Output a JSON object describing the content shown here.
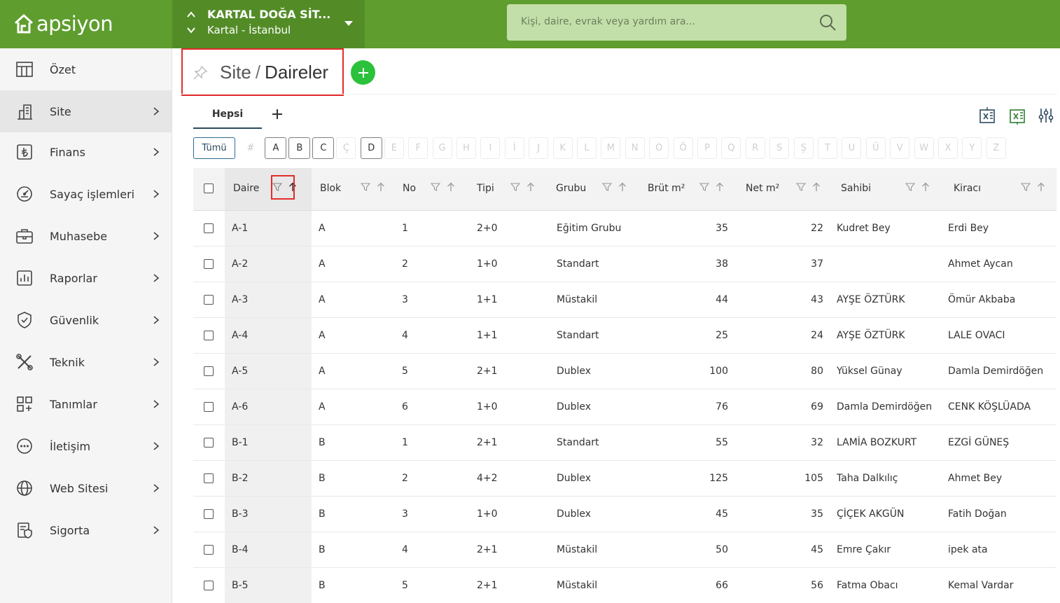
{
  "brand": {
    "name": "apsiyon"
  },
  "site_switch": {
    "name": "KARTAL DOĞA SİT...",
    "location": "Kartal - İstanbul"
  },
  "search": {
    "placeholder": "Kişi, daire, evrak veya yardım ara..."
  },
  "sidebar": {
    "items": [
      {
        "label": "Özet",
        "icon": "table-icon",
        "arrow": false
      },
      {
        "label": "Site",
        "icon": "building-icon",
        "arrow": true,
        "active": true
      },
      {
        "label": "Finans",
        "icon": "lira-icon",
        "arrow": true
      },
      {
        "label": "Sayaç işlemleri",
        "icon": "gauge-icon",
        "arrow": true
      },
      {
        "label": "Muhasebe",
        "icon": "briefcase-icon",
        "arrow": true
      },
      {
        "label": "Raporlar",
        "icon": "report-icon",
        "arrow": true
      },
      {
        "label": "Güvenlik",
        "icon": "shield-icon",
        "arrow": true
      },
      {
        "label": "Teknik",
        "icon": "tools-icon",
        "arrow": true
      },
      {
        "label": "Tanımlar",
        "icon": "grid-plus-icon",
        "arrow": true
      },
      {
        "label": "İletişim",
        "icon": "chat-icon",
        "arrow": true
      },
      {
        "label": "Web Sitesi",
        "icon": "globe-icon",
        "arrow": true
      },
      {
        "label": "Sigorta",
        "icon": "insurance-icon",
        "arrow": true
      }
    ]
  },
  "header": {
    "section": "Site",
    "separator": "/",
    "title": "Daireler"
  },
  "tabs": [
    {
      "label": "Hepsi"
    }
  ],
  "letters": {
    "all_label": "Tümü",
    "items": [
      "#",
      "A",
      "B",
      "C",
      "Ç",
      "D",
      "E",
      "F",
      "G",
      "H",
      "I",
      "İ",
      "J",
      "K",
      "L",
      "M",
      "N",
      "O",
      "Ö",
      "P",
      "Q",
      "R",
      "S",
      "Ş",
      "T",
      "U",
      "Ü",
      "V",
      "W",
      "X",
      "Y",
      "Z"
    ],
    "enabled": [
      "A",
      "B",
      "C",
      "D"
    ]
  },
  "table": {
    "columns": [
      "Daire",
      "Blok",
      "No",
      "Tipi",
      "Grubu",
      "Brüt m²",
      "Net m²",
      "Sahibi",
      "Kiracı"
    ],
    "rows": [
      [
        "A-1",
        "A",
        "1",
        "2+0",
        "Eğitim Grubu",
        "35",
        "22",
        "Kudret Bey",
        "Erdi Bey"
      ],
      [
        "A-2",
        "A",
        "2",
        "1+0",
        "Standart",
        "38",
        "37",
        "",
        "Ahmet Aycan"
      ],
      [
        "A-3",
        "A",
        "3",
        "1+1",
        "Müstakil",
        "44",
        "43",
        "AYŞE ÖZTÜRK",
        "Ömür Akbaba"
      ],
      [
        "A-4",
        "A",
        "4",
        "1+1",
        "Standart",
        "25",
        "24",
        "AYŞE ÖZTÜRK",
        "LALE OVACI"
      ],
      [
        "A-5",
        "A",
        "5",
        "2+1",
        "Dublex",
        "100",
        "80",
        "Yüksel Günay",
        "Damla Demirdöğen"
      ],
      [
        "A-6",
        "A",
        "6",
        "1+0",
        "Dublex",
        "76",
        "69",
        "Damla Demirdöğen",
        "CENK KÖŞLÜADA"
      ],
      [
        "B-1",
        "B",
        "1",
        "2+1",
        "Standart",
        "55",
        "32",
        "LAMİA BOZKURT",
        "EZGİ GÜNEŞ"
      ],
      [
        "B-2",
        "B",
        "2",
        "4+2",
        "Dublex",
        "125",
        "105",
        "Taha Dalkılıç",
        "Ahmet Bey"
      ],
      [
        "B-3",
        "B",
        "3",
        "1+0",
        "Dublex",
        "45",
        "35",
        "ÇİÇEK AKGÜN",
        "Fatih Doğan"
      ],
      [
        "B-4",
        "B",
        "4",
        "2+1",
        "Müstakil",
        "50",
        "45",
        "Emre Çakır",
        "ipek ata"
      ],
      [
        "B-5",
        "B",
        "5",
        "2+1",
        "Müstakil",
        "66",
        "56",
        "Fatma Obacı",
        "Kemal Vardar"
      ]
    ]
  },
  "colors": {
    "brand_green": "#5e9d2e",
    "add_green": "#2cc13a",
    "highlight_red": "#e32b2b"
  }
}
